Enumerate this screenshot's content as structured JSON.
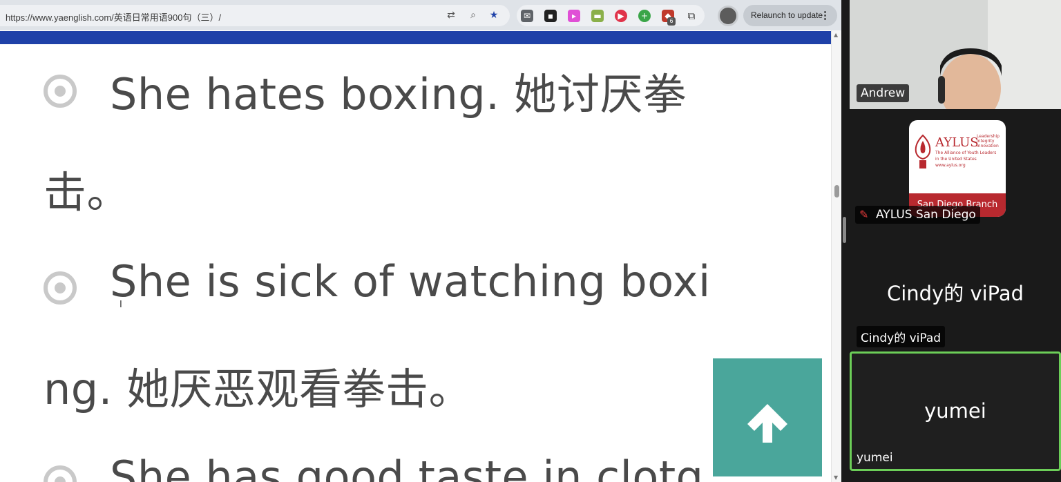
{
  "browser": {
    "url": "https://www.yaenglish.com/英语日常用语900句（三）/",
    "relaunch_label": "Relaunch to update",
    "ext_badge": "6"
  },
  "lesson": {
    "lines": [
      "She hates boxing. 她讨厌拳",
      "击。",
      "She is sick of watching boxi",
      "ng. 她厌恶观看拳击。",
      "She has good taste in clotg"
    ]
  },
  "participants": {
    "andrew": "Andrew",
    "aylus_name": "AYLUS San Diego",
    "cindy_name": "Cindy的 viPad",
    "cindy_big": "Cindy的 viPad",
    "yumei_name": "yumei",
    "yumei_big": "yumei"
  },
  "logo": {
    "title": "AYLUS",
    "tagline1": "Leadership",
    "tagline2": "Integrity",
    "tagline3": "Innovation",
    "alliance1": "The Alliance of Youth Leaders",
    "alliance2": "in the United States",
    "web": "www.aylus.org",
    "branch": "San Diego Branch"
  },
  "colors": {
    "accent_blue": "#1f41a8",
    "back_to_top": "#4aa69b",
    "active_speaker": "#6cce58",
    "logo_red": "#b8292f"
  }
}
